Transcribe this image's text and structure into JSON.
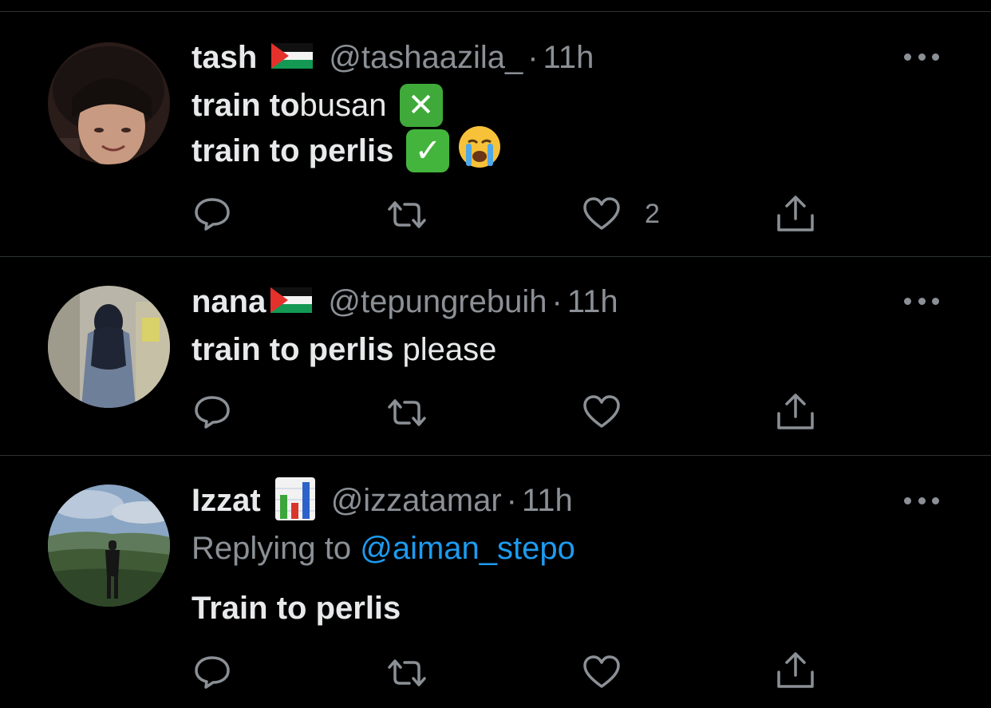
{
  "colors": {
    "background": "#000000",
    "text": "#e7e9ea",
    "secondary": "#8b9096",
    "link": "#1d9bf0",
    "divider": "#2f3336"
  },
  "tweets": [
    {
      "name": "tash",
      "name_emoji": "palestine-flag-icon",
      "handle": "@tashaazila_",
      "separator": "·",
      "time": "11h",
      "lines": [
        {
          "bold": "train to",
          "regular": " busan",
          "emoji": "cross-mark-icon"
        },
        {
          "bold": "train to perlis",
          "regular": "",
          "emoji": "check-mark-icon",
          "emoji2": "crying-face-icon"
        }
      ],
      "actions": {
        "reply_count": "",
        "retweet_count": "",
        "like_count": "2"
      }
    },
    {
      "name": "nana",
      "name_emoji": "palestine-flag-icon",
      "handle": "@tepungrebuih",
      "separator": "·",
      "time": "11h",
      "lines": [
        {
          "bold": "train to perlis",
          "regular": " please"
        }
      ],
      "actions": {
        "reply_count": "",
        "retweet_count": "",
        "like_count": ""
      }
    },
    {
      "name": "Izzat",
      "name_emoji": "bar-chart-icon",
      "handle": "@izzatamar",
      "separator": "·",
      "time": "11h",
      "replying_prefix": "Replying to ",
      "replying_to": "@aiman_stepo",
      "lines": [
        {
          "bold": "Train to perlis",
          "regular": ""
        }
      ],
      "actions": {
        "reply_count": "",
        "retweet_count": "",
        "like_count": ""
      }
    }
  ]
}
